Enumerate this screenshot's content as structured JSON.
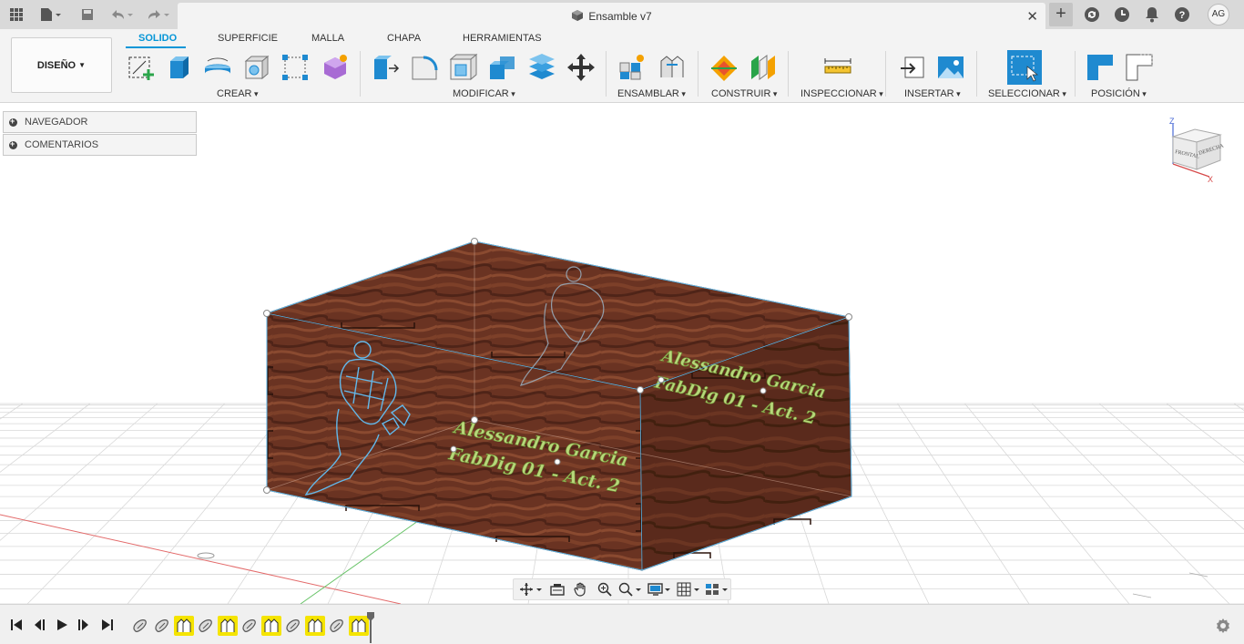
{
  "app": {
    "doc_title": "Ensamble v7",
    "user_initials": "AG",
    "icons": [
      "grid-menu-icon",
      "file-icon",
      "save-icon",
      "undo-icon",
      "redo-icon",
      "close-icon",
      "plus-icon",
      "sync-icon",
      "clock-icon",
      "bell-icon",
      "help-icon"
    ]
  },
  "ribbon": {
    "workspace": "DISEÑO",
    "tabs": [
      "SOLIDO",
      "SUPERFICIE",
      "MALLA",
      "CHAPA",
      "HERRAMIENTAS"
    ],
    "active_tab": "SOLIDO",
    "groups": [
      "CREAR",
      "MODIFICAR",
      "ENSAMBLAR",
      "CONSTRUIR",
      "INSPECCIONAR",
      "INSERTAR",
      "SELECCIONAR",
      "POSICIÓN"
    ]
  },
  "browser": {
    "panels": [
      "NAVEGADOR",
      "COMENTARIOS"
    ]
  },
  "viewcube": {
    "front": "FRONTAL",
    "right": "DERECHA",
    "axis_z": "Z",
    "axis_x": "X"
  },
  "model": {
    "engraving_line1": "Alessandro Garcia",
    "engraving_line2": "FabDig 01 - Act. 2",
    "colors": {
      "wood": "#6b3220",
      "engrave": "#b7d77a",
      "outline": "#5fb7e8"
    }
  },
  "timeline": {
    "features": [
      "body",
      "body",
      "joint",
      "body",
      "joint",
      "body",
      "joint",
      "body",
      "joint",
      "body",
      "joint"
    ]
  },
  "colors": {
    "accent": "#0696d7",
    "joint": "#f5e400"
  }
}
